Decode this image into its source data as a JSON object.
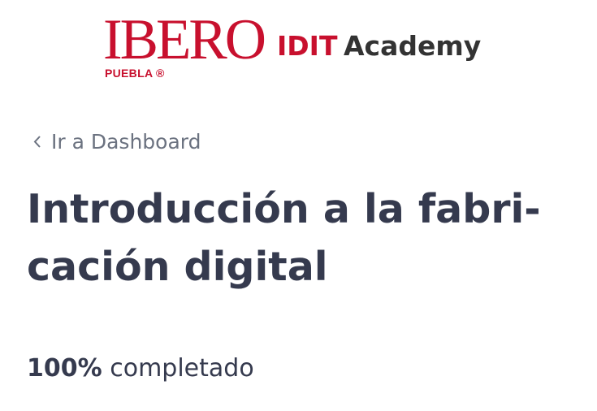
{
  "header": {
    "logo_primary": "IBERO",
    "logo_sub": "PUEBLA ®",
    "logo_idit": "IDIT",
    "logo_academy": "Academy"
  },
  "nav": {
    "back_label": "Ir a Dashboard",
    "back_icon": "chevron-left-icon"
  },
  "course": {
    "title_line1": "Introducción a la fabri-",
    "title_line2": "cación digital",
    "progress_value": "100%",
    "progress_label": "completado"
  },
  "colors": {
    "brand_red": "#c8102e",
    "title_text": "#353a4e",
    "muted_text": "#6b7280"
  }
}
